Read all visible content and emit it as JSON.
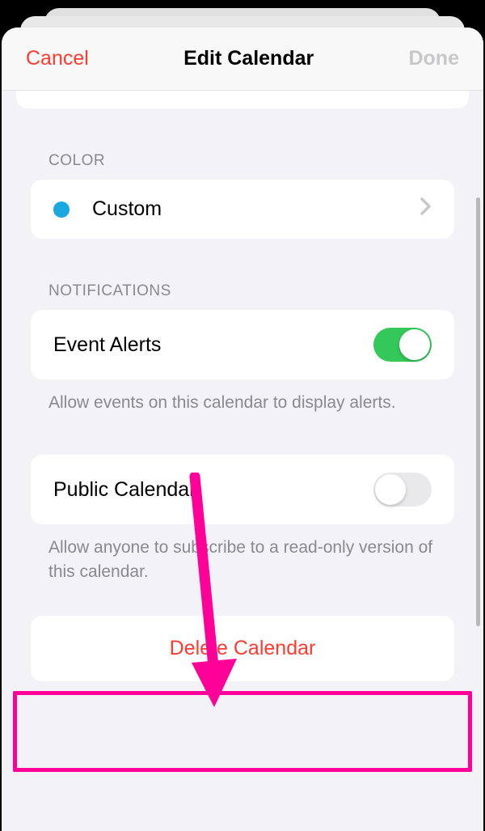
{
  "nav": {
    "cancel": "Cancel",
    "title": "Edit Calendar",
    "done": "Done"
  },
  "color_section": {
    "header": "COLOR",
    "color_name": "Custom",
    "color_value": "#1ba8e0"
  },
  "notifications_section": {
    "header": "NOTIFICATIONS",
    "event_alerts": {
      "label": "Event Alerts",
      "enabled": true
    },
    "event_alerts_footer": "Allow events on this calendar to display alerts.",
    "public_calendar": {
      "label": "Public Calendar",
      "enabled": false
    },
    "public_calendar_footer": "Allow anyone to subscribe to a read-only version of this calendar."
  },
  "delete_button": "Delete Calendar",
  "annotation": {
    "highlight_target": "delete-calendar-button",
    "arrow_color": "#ff0099"
  }
}
